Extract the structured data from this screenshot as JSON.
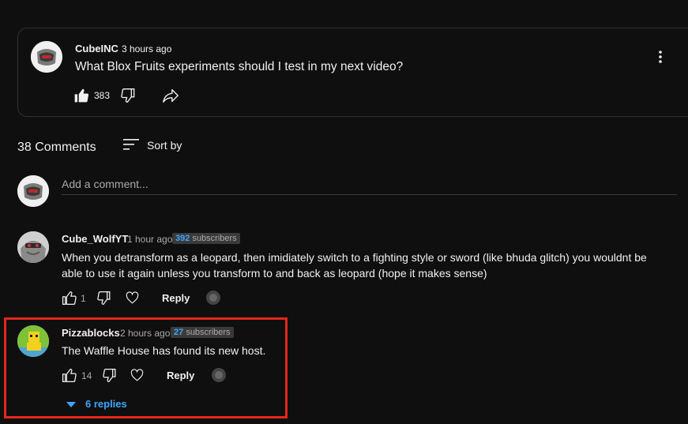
{
  "pinned_post": {
    "author": "CubeINC",
    "time": "3 hours ago",
    "text": "What Blox Fruits experiments should I test in my next video?",
    "likes": "383"
  },
  "comments_header": {
    "count_label": "38 Comments",
    "sort_label": "Sort by"
  },
  "add_comment": {
    "placeholder": "Add a comment..."
  },
  "comments": [
    {
      "author": "Cube_WolfYT",
      "time": "1 hour ago",
      "subscribers_count": "392",
      "subscribers_label": "subscribers",
      "text": "When you detransform as a leopard, then imidiately switch to a fighting style or sword (like bhuda glitch) you wouldnt be able to use it again unless you transform to and back as leopard (hope it makes sense)",
      "likes": "1",
      "reply_label": "Reply"
    },
    {
      "author": "Pizzablocks",
      "time": "2 hours ago",
      "subscribers_count": "27",
      "subscribers_label": "subscribers",
      "text": "The Waffle House has found its new host.",
      "likes": "14",
      "reply_label": "Reply",
      "replies_label": "6 replies"
    }
  ],
  "colors": {
    "background": "#0f0f0f",
    "accent_link": "#3ea6ff",
    "highlight_border": "#e5261c"
  }
}
